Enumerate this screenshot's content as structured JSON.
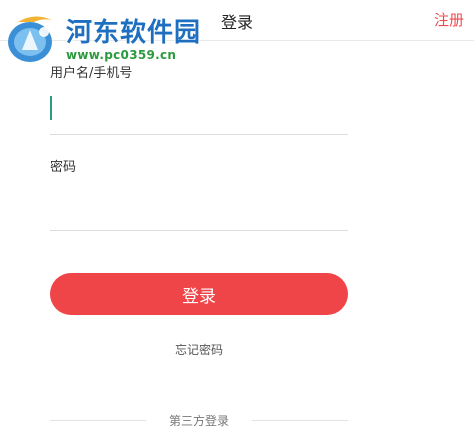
{
  "header": {
    "title": "登录",
    "register_label": "注册"
  },
  "watermark": {
    "name": "河东软件园",
    "url": "www.pc0359.cn"
  },
  "form": {
    "username_label": "用户名/手机号",
    "username_value": "",
    "password_label": "密码",
    "password_value": "",
    "login_label": "登录",
    "forgot_label": "忘记密码",
    "third_party_label": "第三方登录"
  },
  "colors": {
    "accent": "#ef4448",
    "cursor": "#2a9f7f",
    "watermark_name": "#1f6fc0",
    "watermark_url": "#2b9a3f"
  }
}
